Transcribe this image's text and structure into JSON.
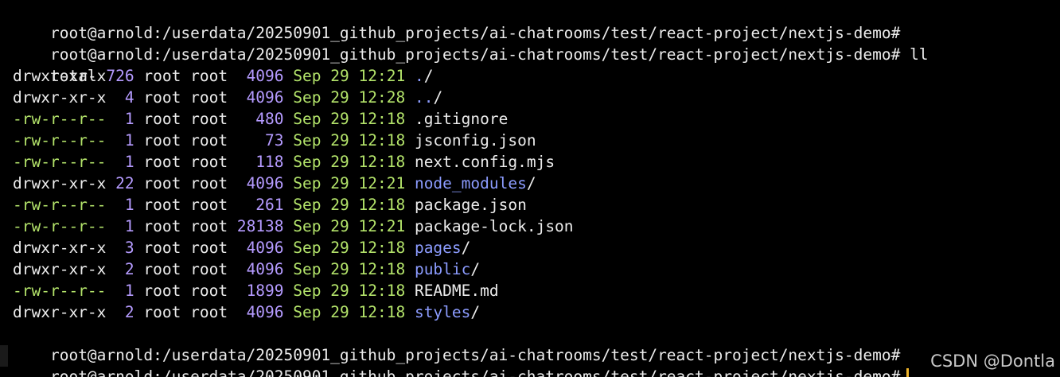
{
  "terminal": {
    "prompt_path": "root@arnold:/userdata/20250901_github_projects/ai-chatrooms/test/react-project/nextjs-demo#",
    "command": "ll",
    "total_label": "total",
    "total_value": "72",
    "listing": [
      {
        "perms": "drwxr-xr-x",
        "links": " 6",
        "owner": "root",
        "group": "root",
        "size": " 4096",
        "month": "Sep",
        "day": "29",
        "time": "12:21",
        "name": "./",
        "is_dir": true,
        "dir_base": ".",
        "dir_suffix": "/"
      },
      {
        "perms": "drwxr-xr-x",
        "links": " 4",
        "owner": "root",
        "group": "root",
        "size": " 4096",
        "month": "Sep",
        "day": "29",
        "time": "12:28",
        "name": "../",
        "is_dir": true,
        "dir_base": "..",
        "dir_suffix": "/"
      },
      {
        "perms": "-rw-r--r--",
        "links": " 1",
        "owner": "root",
        "group": "root",
        "size": "  480",
        "month": "Sep",
        "day": "29",
        "time": "12:18",
        "name": ".gitignore",
        "is_dir": false
      },
      {
        "perms": "-rw-r--r--",
        "links": " 1",
        "owner": "root",
        "group": "root",
        "size": "   73",
        "month": "Sep",
        "day": "29",
        "time": "12:18",
        "name": "jsconfig.json",
        "is_dir": false
      },
      {
        "perms": "-rw-r--r--",
        "links": " 1",
        "owner": "root",
        "group": "root",
        "size": "  118",
        "month": "Sep",
        "day": "29",
        "time": "12:18",
        "name": "next.config.mjs",
        "is_dir": false
      },
      {
        "perms": "drwxr-xr-x",
        "links": "22",
        "owner": "root",
        "group": "root",
        "size": " 4096",
        "month": "Sep",
        "day": "29",
        "time": "12:21",
        "name": "node_modules/",
        "is_dir": true,
        "dir_base": "node_modules",
        "dir_suffix": "/"
      },
      {
        "perms": "-rw-r--r--",
        "links": " 1",
        "owner": "root",
        "group": "root",
        "size": "  261",
        "month": "Sep",
        "day": "29",
        "time": "12:18",
        "name": "package.json",
        "is_dir": false
      },
      {
        "perms": "-rw-r--r--",
        "links": " 1",
        "owner": "root",
        "group": "root",
        "size": "28138",
        "month": "Sep",
        "day": "29",
        "time": "12:21",
        "name": "package-lock.json",
        "is_dir": false
      },
      {
        "perms": "drwxr-xr-x",
        "links": " 3",
        "owner": "root",
        "group": "root",
        "size": " 4096",
        "month": "Sep",
        "day": "29",
        "time": "12:18",
        "name": "pages/",
        "is_dir": true,
        "dir_base": "pages",
        "dir_suffix": "/"
      },
      {
        "perms": "drwxr-xr-x",
        "links": " 2",
        "owner": "root",
        "group": "root",
        "size": " 4096",
        "month": "Sep",
        "day": "29",
        "time": "12:18",
        "name": "public/",
        "is_dir": true,
        "dir_base": "public",
        "dir_suffix": "/"
      },
      {
        "perms": "-rw-r--r--",
        "links": " 1",
        "owner": "root",
        "group": "root",
        "size": " 1899",
        "month": "Sep",
        "day": "29",
        "time": "12:18",
        "name": "README.md",
        "is_dir": false
      },
      {
        "perms": "drwxr-xr-x",
        "links": " 2",
        "owner": "root",
        "group": "root",
        "size": " 4096",
        "month": "Sep",
        "day": "29",
        "time": "12:18",
        "name": "styles/",
        "is_dir": true,
        "dir_base": "styles",
        "dir_suffix": "/"
      }
    ]
  },
  "watermark": "CSDN @Dontla",
  "colors": {
    "background": "#000000",
    "text": "#ececec",
    "green": "#b3e36a",
    "purple": "#b59bff",
    "directory": "#8c9cff",
    "cursor": "#f0b429"
  }
}
